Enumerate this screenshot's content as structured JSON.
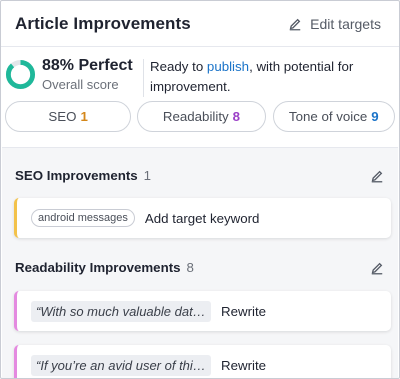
{
  "header": {
    "title": "Article Improvements",
    "edit_targets": "Edit targets"
  },
  "score": {
    "percent_value": 0.88,
    "percent_text": "88% Perfect",
    "label": "Overall score",
    "ready_prefix": "Ready to ",
    "ready_link": "publish",
    "ready_suffix": ", with potential for improvement."
  },
  "pills": [
    {
      "label": "SEO",
      "count": "1",
      "color": "#d4871a"
    },
    {
      "label": "Readability",
      "count": "8",
      "color": "#9b3fc7"
    },
    {
      "label": "Tone of voice",
      "count": "9",
      "color": "#1a73c8"
    }
  ],
  "seo_section": {
    "title": "SEO Improvements",
    "count": "1",
    "items": [
      {
        "chip": "android messages",
        "action": "Add target keyword"
      }
    ]
  },
  "readability_section": {
    "title": "Readability Improvements",
    "count": "8",
    "items": [
      {
        "quote": "“With so much valuable dat…",
        "action": "Rewrite"
      },
      {
        "quote": "“If you’re an avid user of thi…",
        "action": "Rewrite"
      }
    ]
  },
  "colors": {
    "score_ring": "#1fb89a",
    "seo_accent": "#f3c24a",
    "readability_accent": "#e48ae0",
    "link": "#1a73c8"
  }
}
